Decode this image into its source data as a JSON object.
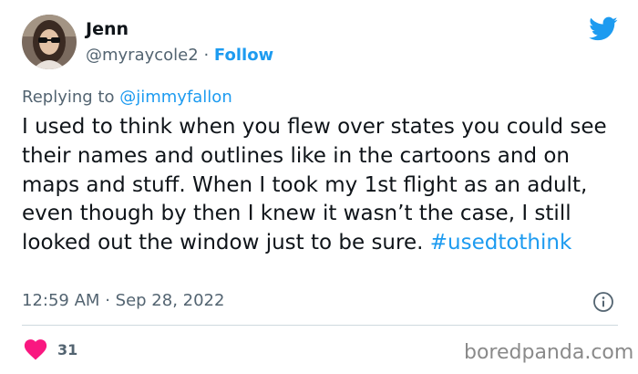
{
  "author": {
    "name": "Jenn",
    "handle": "@myraycole2",
    "separator": "·",
    "follow_label": "Follow"
  },
  "reply": {
    "prefix": "Replying to",
    "mention": "@jimmyfallon"
  },
  "tweet": {
    "text": "I used to think when you flew over states you could see their names and outlines like in the cartoons and on maps and stuff. When I took my 1st flight as an adult, even though by then I knew it wasn’t the case, I still looked out the window just to be sure.",
    "hashtag": "#usedtothink"
  },
  "meta": {
    "time": "12:59 AM",
    "separator": "·",
    "date": "Sep 28, 2022"
  },
  "engagement": {
    "likes": "31"
  },
  "watermark": "boredpanda.com",
  "icons": {
    "logo": "twitter-bird-icon",
    "info": "info-icon",
    "like": "heart-icon"
  },
  "colors": {
    "accent": "#1d9bf0",
    "secondary_text": "#536471",
    "heart": "#f91880",
    "divider": "#cfd9de"
  }
}
